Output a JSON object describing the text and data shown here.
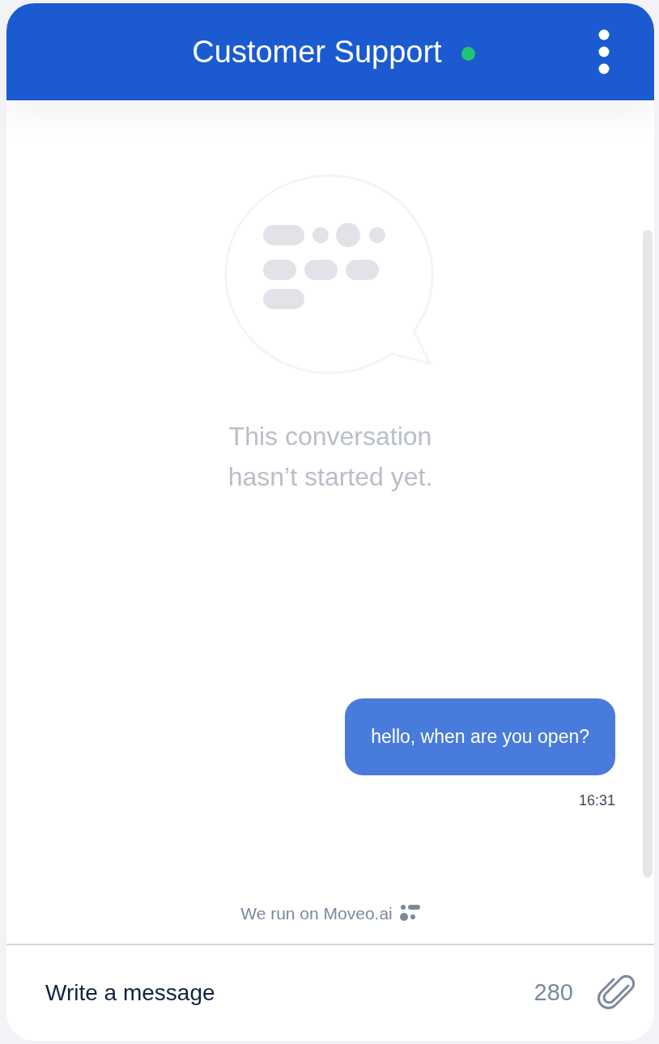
{
  "header": {
    "title": "Customer Support",
    "online": true
  },
  "empty_state": {
    "text": "This conversation hasn’t started yet."
  },
  "messages": [
    {
      "text": "hello, when are you open?",
      "time": "16:31",
      "kind": "outgoing"
    }
  ],
  "branding": {
    "text": "We run on Moveo.ai"
  },
  "composer": {
    "placeholder": "Write a message",
    "counter": "280"
  }
}
